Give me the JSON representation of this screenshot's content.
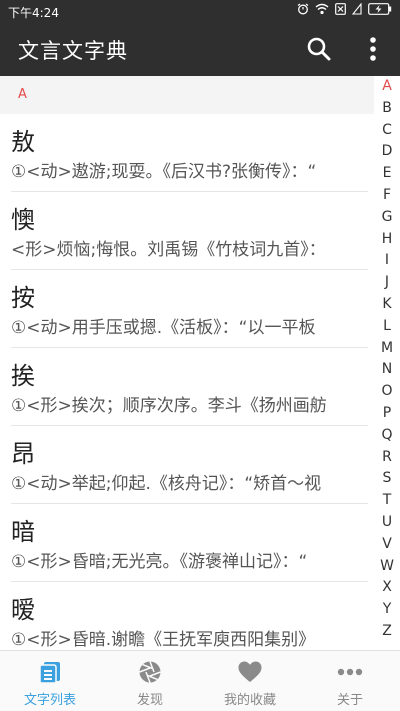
{
  "status_bar": {
    "time": "下午4:24"
  },
  "app_bar": {
    "title": "文言文字典"
  },
  "section": {
    "label": "A"
  },
  "entries": [
    {
      "char": "敖",
      "def": "①<动>遨游;现耍。《后汉书?张衡传》：“"
    },
    {
      "char": "懊",
      "def": "<形>烦恼;悔恨。刘禹锡《竹枝词九首》："
    },
    {
      "char": "按",
      "def": "①<动>用手压或摁.《活板》：“以一平板"
    },
    {
      "char": "挨",
      "def": "①<形>挨次；顺序次序。李斗《扬州画舫"
    },
    {
      "char": "昂",
      "def": "①<动>举起;仰起.《核舟记》：“矫首～视"
    },
    {
      "char": "暗",
      "def": "①<形>昏暗;无光亮。《游褒禅山记》：“"
    },
    {
      "char": "暧",
      "def": "①<形>昏暗.谢瞻《王抚军庾西阳集别》"
    }
  ],
  "index_letters": [
    "A",
    "B",
    "C",
    "D",
    "E",
    "F",
    "G",
    "H",
    "I",
    "J",
    "K",
    "L",
    "M",
    "N",
    "O",
    "P",
    "Q",
    "R",
    "S",
    "T",
    "U",
    "V",
    "W",
    "X",
    "Y",
    "Z"
  ],
  "index_active": "A",
  "bottom_nav": [
    {
      "label": "文字列表",
      "icon": "list-icon",
      "active": true
    },
    {
      "label": "发现",
      "icon": "aperture-icon",
      "active": false
    },
    {
      "label": "我的收藏",
      "icon": "heart-icon",
      "active": false
    },
    {
      "label": "关于",
      "icon": "more-dots-icon",
      "active": false
    }
  ],
  "colors": {
    "bar": "#2f2f2f",
    "accent": "#3aa0df",
    "index_active": "#e44a4a"
  }
}
